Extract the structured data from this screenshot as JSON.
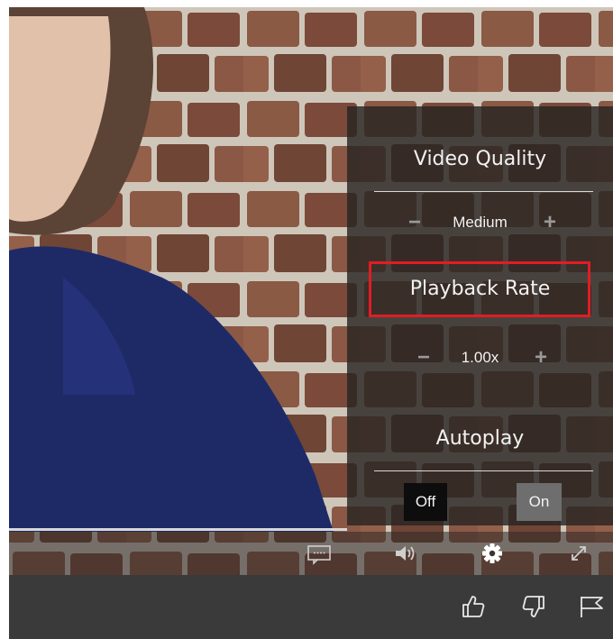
{
  "settings": {
    "video_quality": {
      "title": "Video Quality",
      "value": "Medium",
      "minus": "−",
      "plus": "+"
    },
    "playback_rate": {
      "title": "Playback Rate",
      "value": "1.00x",
      "minus": "−",
      "plus": "+"
    },
    "autoplay": {
      "title": "Autoplay",
      "off_label": "Off",
      "on_label": "On",
      "selected": "Off"
    }
  },
  "controls": {
    "icons": [
      "captions-icon",
      "volume-icon",
      "settings-gear-icon",
      "fullscreen-icon"
    ]
  },
  "actions": {
    "icons": [
      "thumbs-up-icon",
      "thumbs-down-icon",
      "flag-icon"
    ]
  },
  "colors": {
    "highlight": "#e21c23",
    "panel": "#282422",
    "bottom_bar": "#3a3a3a"
  }
}
